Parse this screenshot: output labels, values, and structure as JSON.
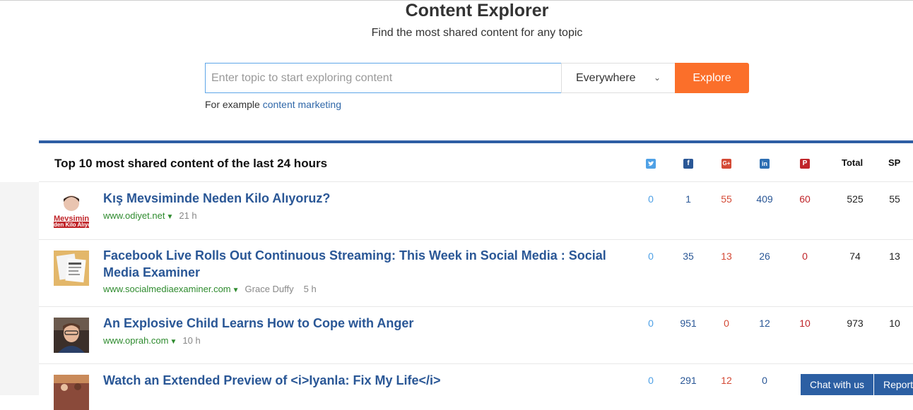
{
  "header": {
    "title": "Content Explorer",
    "subtitle": "Find the most shared content for any topic"
  },
  "search": {
    "placeholder": "Enter topic to start exploring content",
    "scope": "Everywhere",
    "button": "Explore",
    "example_prefix": "For example",
    "example_link": "content marketing"
  },
  "panel": {
    "title": "Top 10 most shared content of the last 24 hours",
    "columns": {
      "twitter": "twitter-icon",
      "facebook": "facebook-icon",
      "googleplus": "googleplus-icon",
      "linkedin": "linkedin-icon",
      "pinterest": "pinterest-icon",
      "total": "Total",
      "sp": "SP"
    }
  },
  "rows": [
    {
      "title": "Kış Mevsiminde Neden Kilo Alıyoruz?",
      "domain": "www.odiyet.net",
      "author": "",
      "age": "21 h",
      "thumb_text_1": "Mevsimin",
      "thumb_text_2": "den Kilo Alıyo",
      "twitter": "0",
      "facebook": "1",
      "googleplus": "55",
      "linkedin": "409",
      "pinterest": "60",
      "total": "525",
      "sp": "55"
    },
    {
      "title": "Facebook Live Rolls Out Continuous Streaming: This Week in Social Media : Social Media Examiner",
      "domain": "www.socialmediaexaminer.com",
      "author": "Grace Duffy",
      "age": "5 h",
      "twitter": "0",
      "facebook": "35",
      "googleplus": "13",
      "linkedin": "26",
      "pinterest": "0",
      "total": "74",
      "sp": "13"
    },
    {
      "title": "An Explosive Child Learns How to Cope with Anger",
      "domain": "www.oprah.com",
      "author": "",
      "age": "10 h",
      "twitter": "0",
      "facebook": "951",
      "googleplus": "0",
      "linkedin": "12",
      "pinterest": "10",
      "total": "973",
      "sp": "10"
    },
    {
      "title": "Watch an Extended Preview of <i>Iyanla: Fix My Life</i>",
      "domain": "",
      "author": "",
      "age": "",
      "twitter": "0",
      "facebook": "291",
      "googleplus": "12",
      "linkedin": "0",
      "pinterest": "",
      "total": "",
      "sp": ""
    }
  ],
  "footer": {
    "chat": "Chat with us",
    "report": "Report"
  },
  "colors": {
    "accent_orange": "#fb6f2a",
    "brand_blue": "#2e5ea4",
    "link_blue": "#2a5796",
    "domain_green": "#2e8b2e"
  }
}
